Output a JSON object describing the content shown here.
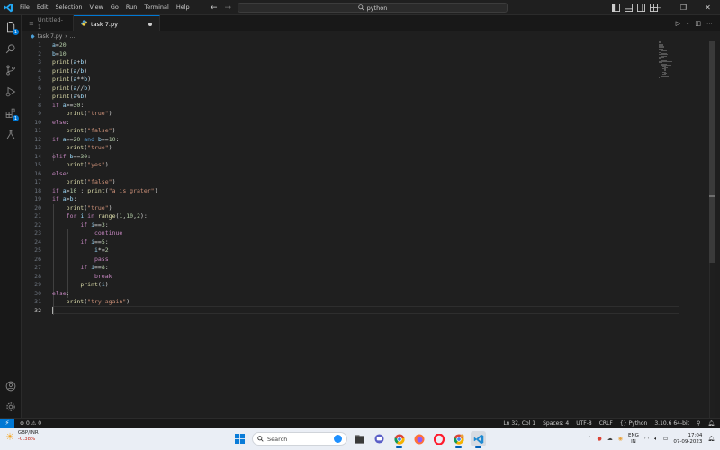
{
  "titlebar": {
    "menu": [
      "File",
      "Edit",
      "Selection",
      "View",
      "Go",
      "Run",
      "Terminal",
      "Help"
    ],
    "search": "python",
    "app_icon": "vscode-logo",
    "window_controls": [
      "minimize",
      "maximize",
      "close"
    ]
  },
  "tabs": [
    {
      "label": "Untitled-1",
      "icon": "file-icon",
      "active": false
    },
    {
      "label": "task 7.py",
      "icon": "python-file-icon",
      "active": true,
      "dirty": true
    }
  ],
  "breadcrumb": {
    "file": "task 7.py",
    "rest": "..."
  },
  "activity_bar": {
    "icons": [
      "explorer-icon",
      "search-icon",
      "source-control-icon",
      "run-debug-icon",
      "extensions-icon",
      "testing-icon"
    ],
    "badges": {
      "explorer": "1",
      "extensions": "1"
    },
    "bottom_icons": [
      "account-icon",
      "settings-gear-icon"
    ]
  },
  "code": [
    "a=20",
    "b=10",
    "print(a+b)",
    "print(a/b)",
    "print(a**b)",
    "print(a//b)",
    "print(a%b)",
    "if a>=30:",
    "    print(\"true\")",
    "else:",
    "    print(\"false\")",
    "if a==20 and b==10:",
    "    print(\"true\")",
    "elif b==30:",
    "    print(\"yes\")",
    "else:",
    "    print(\"false\")",
    "if a>10 : print(\"a is grater\")",
    "if a>b:",
    "    print(\"true\")",
    "    for i in range(1,10,2):",
    "        if i==3:",
    "            continue",
    "        if i==5:",
    "            i*=2",
    "            pass",
    "        if i==8:",
    "            break",
    "        print(i)",
    "else:",
    "    print(\"try again\")",
    ""
  ],
  "statusbar": {
    "errors": "0",
    "warnings": "0",
    "position": "Ln 32, Col 1",
    "spaces": "Spaces: 4",
    "encoding": "UTF-8",
    "eol": "CRLF",
    "language": "Python",
    "interpreter": "3.10.6 64-bit"
  },
  "taskbar": {
    "weather_title": "GBP/INR",
    "weather_change": "-0.38%",
    "search_placeholder": "Search",
    "apps": [
      "start-icon",
      "files-icon",
      "chat-icon",
      "chrome-icon",
      "firefox-icon",
      "opera-icon",
      "chrome-profile-icon",
      "vscode-icon"
    ],
    "language_top": "ENG",
    "language_bottom": "IN",
    "time": "17:04",
    "date": "07-09-2023"
  },
  "colors": {
    "accent": "#0078d4",
    "keyword": "#c586c0",
    "function": "#dcdcaa",
    "string": "#ce9178",
    "number": "#b5cea8",
    "variable": "#9cdcfe"
  }
}
